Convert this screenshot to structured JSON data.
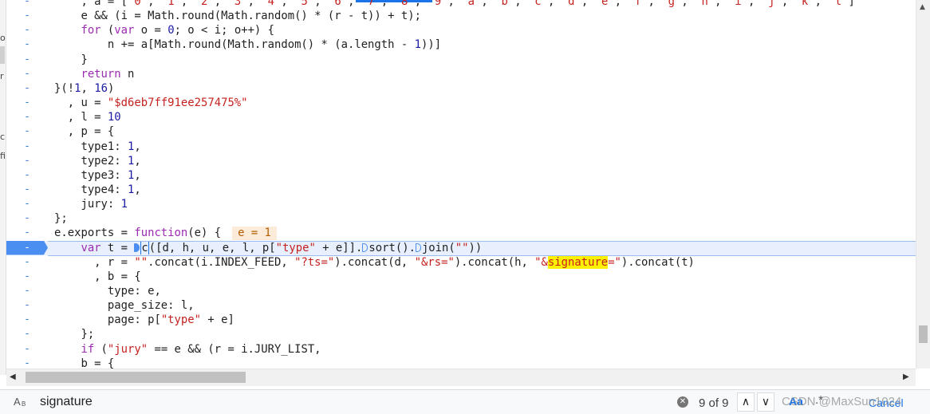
{
  "editor": {
    "lines": [
      {
        "gutter": "-",
        "html": "    <span class=\"k\">for</span> (<span class=\"k\">var</span> o = <span class=\"n\">0</span>; o &lt; i; o++) {"
      },
      {
        "gutter": "-",
        "html": "        n += a[Math.round(Math.random() * (a.length - <span class=\"n\">1</span>))]"
      },
      {
        "gutter": "-",
        "html": "    }"
      },
      {
        "gutter": "-",
        "html": "    <span class=\"k\">return</span> n"
      },
      {
        "gutter": "-",
        "html": "}(!<span class=\"n\">1</span>, <span class=\"n\">16</span>)"
      },
      {
        "gutter": "-",
        "html": "  , u = <span class=\"s\">\"$d6eb7ff91ee257475%\"</span>"
      },
      {
        "gutter": "-",
        "html": "  , l = <span class=\"n\">10</span>"
      },
      {
        "gutter": "-",
        "html": "  , p = {"
      },
      {
        "gutter": "-",
        "html": "    type1: <span class=\"n\">1</span>,"
      },
      {
        "gutter": "-",
        "html": "    type2: <span class=\"n\">1</span>,"
      },
      {
        "gutter": "-",
        "html": "    type3: <span class=\"n\">1</span>,"
      },
      {
        "gutter": "-",
        "html": "    type4: <span class=\"n\">1</span>,"
      },
      {
        "gutter": "-",
        "html": "    jury: <span class=\"n\">1</span>"
      },
      {
        "gutter": "-",
        "html": "};"
      },
      {
        "gutter": "-",
        "html": "e.exports = <span class=\"k\">function</span>(e) {<span class=\"inline-val\">e = 1</span>"
      },
      {
        "gutter": "-",
        "current": true,
        "html": "    <span class=\"k\">var</span> t = <span class=\"bp filled\"></span><span class=\"cursor-wrap\">c</span>([d, h, u, e, l, p[<span class=\"s\">\"type\"</span> + e]].<span class=\"bp\"></span>sort().<span class=\"bp\"></span>join(<span class=\"s\">\"\"</span>))"
      },
      {
        "gutter": "-",
        "html": "      , r = <span class=\"s\">\"\"</span>.concat(i.INDEX_FEED, <span class=\"s\">\"?ts=\"</span>).concat(d, <span class=\"s\">\"&amp;rs=\"</span>).concat(h, <span class=\"s\">\"&amp;<span class=\"hl\">signature</span>=\"</span>).concat(t)"
      },
      {
        "gutter": "-",
        "html": "      , b = {"
      },
      {
        "gutter": "-",
        "html": "        type: e,"
      },
      {
        "gutter": "-",
        "html": "        page_size: l,"
      },
      {
        "gutter": "-",
        "html": "        page: p[<span class=\"s\">\"type\"</span> + e]"
      },
      {
        "gutter": "-",
        "html": "    };"
      },
      {
        "gutter": "-",
        "html": "    <span class=\"k\">if</span> (<span class=\"s\">\"jury\"</span> == e &amp;&amp; (r = i.JURY_LIST,"
      },
      {
        "gutter": "-",
        "html": "    b = {"
      }
    ],
    "partial_top": {
      "gutter": "-",
      "html": "    , a = [<span class=\"s\">\"0\"</span>, <span class=\"s\">\"1\"</span>, <span class=\"s\">\"2\"</span>, <span class=\"s\">\"3\"</span>, <span class=\"s\">\"4\"</span>, <span class=\"s\">\"5\"</span>, <span class=\"s\">\"6\"</span>, <span class=\"s\">\"7\"</span>, <span class=\"s\">\"8\"</span>, <span class=\"s\">\"9\"</span>, <span class=\"s\">\"a\"</span>, <span class=\"s\">\"b\"</span>, <span class=\"s\">\"c\"</span>, <span class=\"s\">\"d\"</span>, <span class=\"s\">\"e\"</span>, <span class=\"s\">\"f\"</span>, <span class=\"s\">\"g\"</span>, <span class=\"s\">\"h\"</span>, <span class=\"s\">\"i\"</span>, <span class=\"s\">\"j\"</span>, <span class=\"s\">\"k\"</span>, <span class=\"s\">\"l\"</span>]"
    },
    "second_line": {
      "gutter": "-",
      "html": "    e &amp;&amp; (i = Math.round(Math.random() * (r - t)) + t);"
    }
  },
  "left_strip": [
    "o",
    "r",
    "c",
    "fi"
  ],
  "search": {
    "case_icon": "A",
    "case_icon_sub": "B",
    "value": "signature",
    "match_count": "9 of 9",
    "prev": "∧",
    "next": "∨",
    "aa_label": "Aa",
    "dot_label": ".*",
    "cancel_label": "Cancel",
    "clear_icon": "✕"
  },
  "scroll": {
    "left_arrow": "◀",
    "right_arrow": "▶",
    "up_arrow": "▲"
  },
  "watermark": "CSDN @MaxSun1024",
  "colors": {
    "accent": "#1a73e8",
    "current_line": "#e8f0fe",
    "highlight": "#fff200",
    "inline_value_bg": "#fdebd9"
  }
}
